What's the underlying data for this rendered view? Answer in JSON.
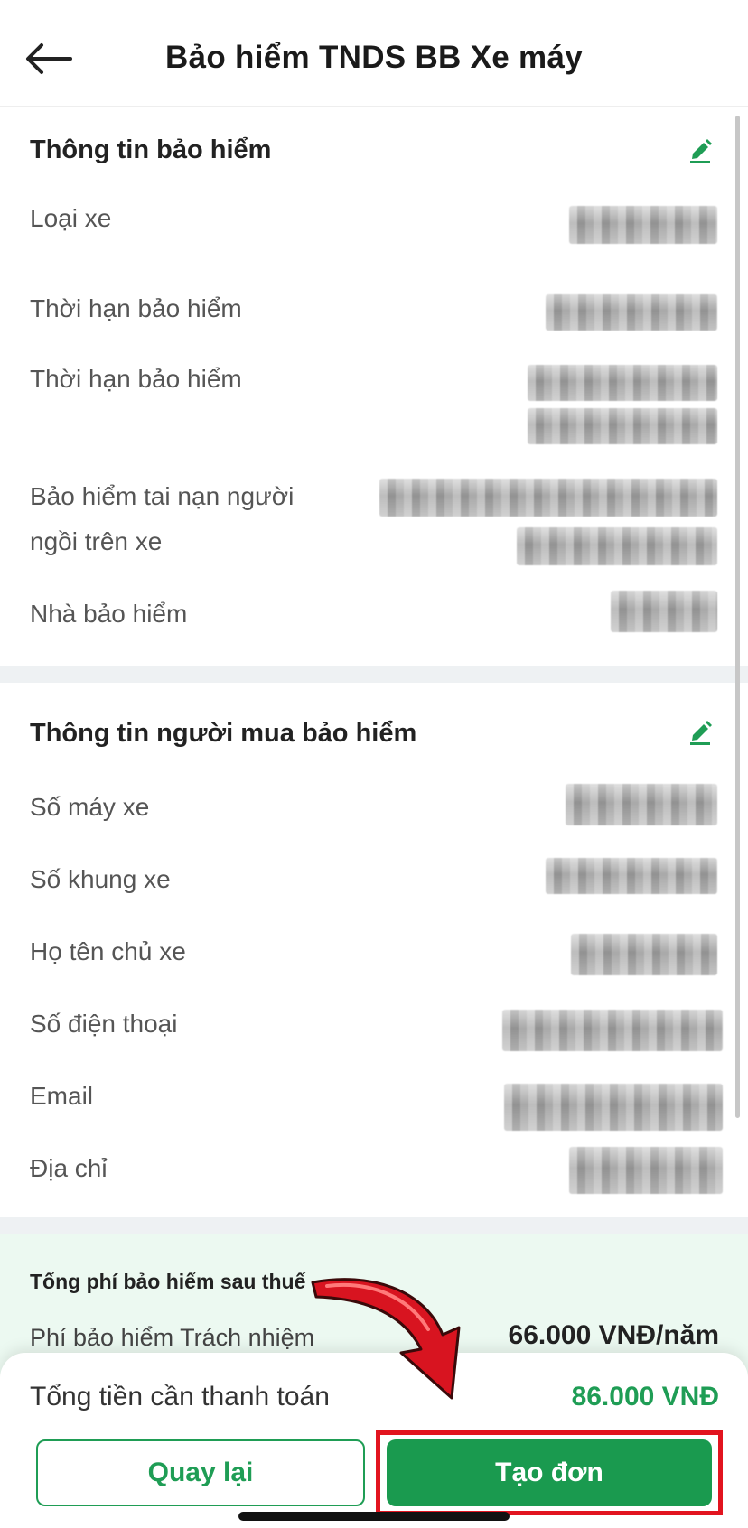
{
  "header": {
    "title": "Bảo hiểm TNDS BB Xe máy"
  },
  "insurance_info": {
    "title": "Thông tin bảo hiểm",
    "rows": [
      {
        "label": "Loại xe"
      },
      {
        "label": "Thời hạn bảo hiểm"
      },
      {
        "label": "Thời hạn bảo hiểm"
      },
      {
        "label": "Bảo hiểm tai nạn người ngồi trên xe",
        "label_line1": "Bảo hiểm tai nạn người",
        "label_line2": "ngồi trên xe"
      },
      {
        "label": "Nhà bảo hiểm"
      }
    ]
  },
  "buyer_info": {
    "title": "Thông tin người mua bảo hiểm",
    "rows": [
      {
        "label": "Số máy xe"
      },
      {
        "label": "Số khung xe"
      },
      {
        "label": "Họ tên chủ xe"
      },
      {
        "label": "Số điện thoại"
      },
      {
        "label": "Email"
      },
      {
        "label": "Địa chỉ"
      }
    ]
  },
  "fees": {
    "heading": "Tổng phí bảo hiểm sau thuế",
    "items": [
      {
        "label": "Phí bảo hiểm Trách nhiệm",
        "value": "66.000 VNĐ/năm"
      }
    ]
  },
  "footer": {
    "total_label": "Tổng tiền cần thanh toán",
    "total_value": "86.000 VNĐ",
    "back_button": "Quay lại",
    "create_button": "Tạo đơn"
  },
  "colors": {
    "accent": "#1f9d55",
    "highlight": "#e2141f",
    "fee_background": "#ecf9f1"
  }
}
